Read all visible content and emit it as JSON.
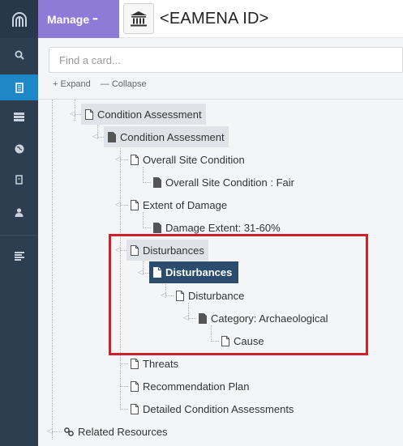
{
  "sidebar": {
    "logo_icon": "arches-logo-icon",
    "items": [
      {
        "icon": "search-icon",
        "active": false
      },
      {
        "icon": "resource-icon",
        "active": true
      },
      {
        "icon": "list-icon",
        "active": false
      },
      {
        "icon": "globe-icon",
        "active": false
      },
      {
        "icon": "book-icon",
        "active": false
      },
      {
        "icon": "user-icon",
        "active": false
      },
      {
        "icon": "menu-lines-icon",
        "active": false
      }
    ]
  },
  "header": {
    "manage_label": "Manage",
    "manage_more": "•••",
    "title": "<EAMENA ID>",
    "title_icon": "institution-icon"
  },
  "search": {
    "placeholder": "Find a card..."
  },
  "tree_controls": {
    "expand_label": "+ Expand",
    "collapse_label": "— Collapse"
  },
  "tree": {
    "condition_assessment_1": "Condition Assessment",
    "condition_assessment_2": "Condition Assessment",
    "overall_site_condition": "Overall Site Condition",
    "overall_site_condition_value": "Overall Site Condition : Fair",
    "extent_of_damage": "Extent of Damage",
    "damage_extent_value": "Damage Extent: 31-60%",
    "disturbances_1": "Disturbances",
    "disturbances_2": "Disturbances",
    "disturbance": "Disturbance",
    "category_value": "Category: Archaeological",
    "cause": "Cause",
    "threats": "Threats",
    "recommendation_plan": "Recommendation Plan",
    "detailed_condition_assessments": "Detailed Condition Assessments",
    "related_resources": "Related Resources"
  },
  "colors": {
    "sidebar": "#2d3e50",
    "active_nav": "#1f87c6",
    "manage": "#8e7bd8",
    "selected_node": "#2b4c6e",
    "highlight_box": "#d0202e"
  }
}
